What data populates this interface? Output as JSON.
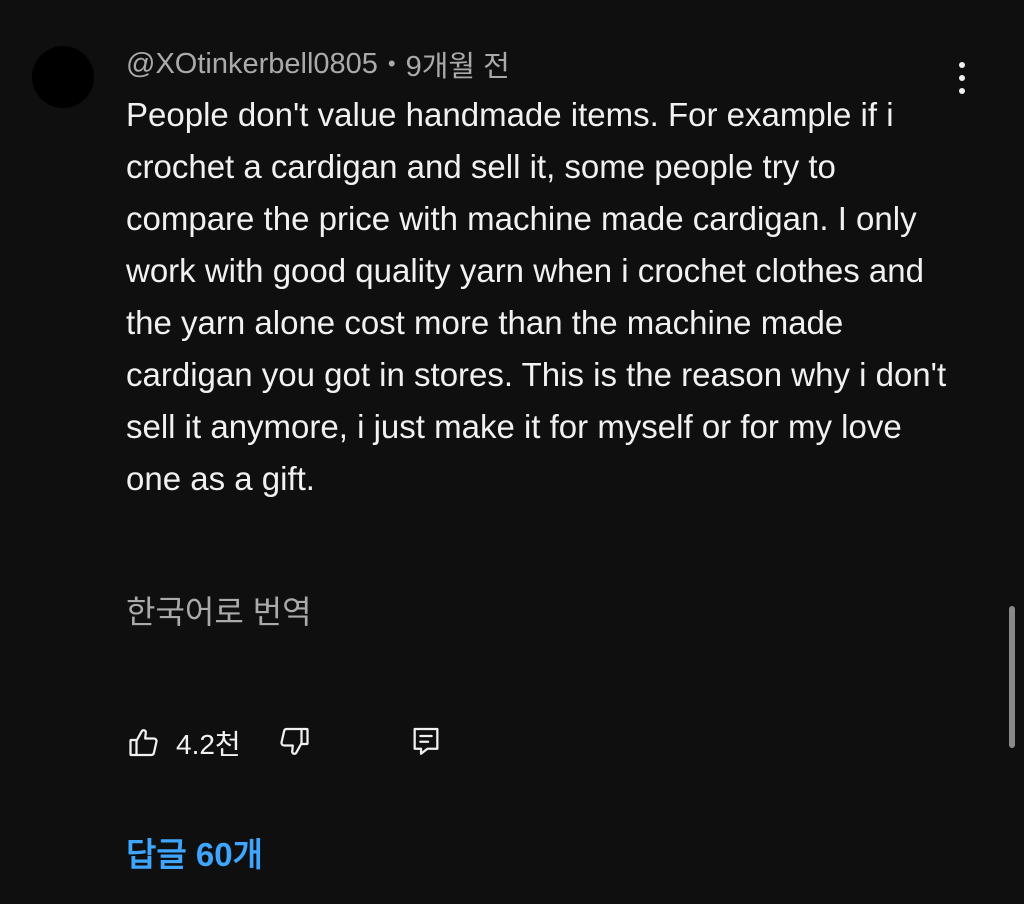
{
  "comment": {
    "author": "@XOtinkerbell0805",
    "separator": "•",
    "time": "9개월 전",
    "text": "People don't value handmade items. For example if i crochet a cardigan and sell it, some people try to compare the price with machine made cardigan. I only work with good quality yarn when i crochet clothes and the yarn alone cost more than the machine made cardigan you got in stores. This is the reason why i don't sell it anymore, i just make it for myself or for my love one as a gift.",
    "translate_label": "한국어로 번역",
    "like_count": "4.2천",
    "replies_label": "답글 60개"
  },
  "icons": {
    "menu": "more-vertical-icon",
    "like": "thumbs-up-icon",
    "dislike": "thumbs-down-icon",
    "reply": "comment-reply-icon"
  },
  "colors": {
    "background": "#0f0f0f",
    "text_primary": "#f1f1f1",
    "text_secondary": "#aaaaaa",
    "link": "#3ea6ff"
  }
}
